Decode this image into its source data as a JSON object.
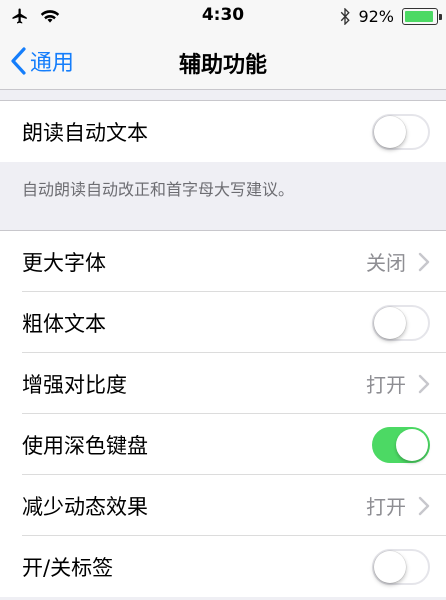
{
  "status_bar": {
    "time": "4:30",
    "battery_percent": "92%",
    "battery_level": 0.92,
    "icons": [
      "airplane-icon",
      "wifi-icon",
      "bluetooth-icon",
      "battery-icon"
    ]
  },
  "nav": {
    "back_label": "通用",
    "title": "辅助功能"
  },
  "group1": {
    "rows": [
      {
        "label": "朗读自动文本",
        "control": "toggle",
        "on": false
      }
    ],
    "footer": "自动朗读自动改正和首字母大写建议。"
  },
  "group2": {
    "rows": [
      {
        "label": "更大字体",
        "control": "disclosure",
        "value": "关闭"
      },
      {
        "label": "粗体文本",
        "control": "toggle",
        "on": false
      },
      {
        "label": "增强对比度",
        "control": "disclosure",
        "value": "打开"
      },
      {
        "label": "使用深色键盘",
        "control": "toggle",
        "on": true
      },
      {
        "label": "减少动态效果",
        "control": "disclosure",
        "value": "打开"
      },
      {
        "label": "开/关标签",
        "control": "toggle",
        "on": false
      }
    ]
  },
  "colors": {
    "accent": "#157efb",
    "toggle_on": "#4cd964",
    "background": "#efeff4"
  }
}
